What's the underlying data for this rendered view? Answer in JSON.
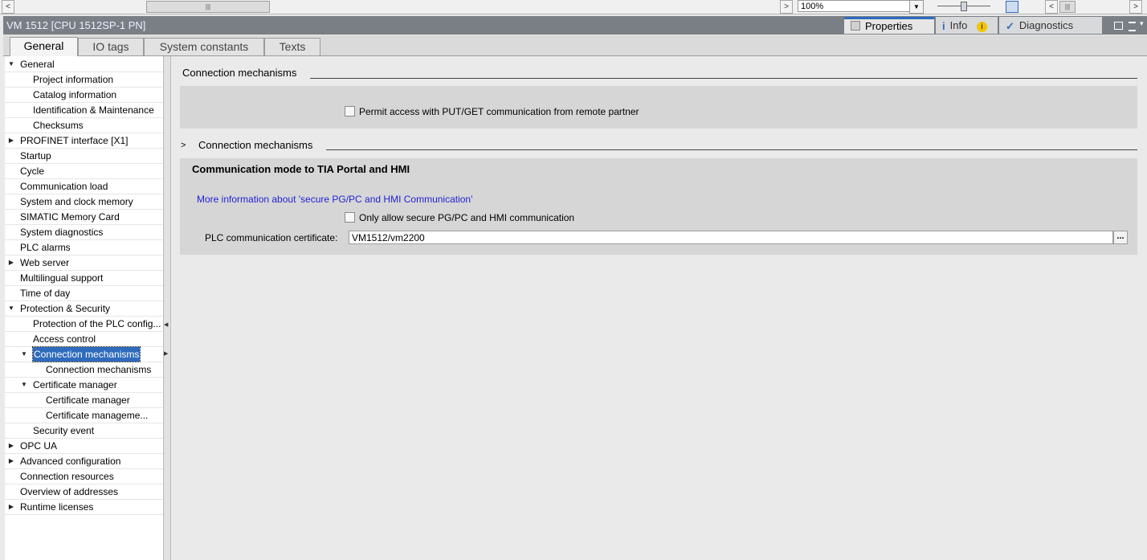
{
  "scrollbar": {
    "left_arrow": "<",
    "thumb_grip": "|||",
    "right_arrow": ">",
    "zoom_value": "100%",
    "zoom_dropdown": "▼",
    "pan_left": "<",
    "pan_grip": "|||",
    "pan_right": ">"
  },
  "inspector": {
    "title": "VM 1512 [CPU 1512SP-1 PN]",
    "tabs": {
      "properties": "Properties",
      "info": "Info",
      "diagnostics": "Diagnostics"
    }
  },
  "property_tabs": [
    "General",
    "IO tags",
    "System constants",
    "Texts"
  ],
  "tree": [
    {
      "label": "General",
      "level": 0,
      "expander": "open"
    },
    {
      "label": "Project information",
      "level": 1
    },
    {
      "label": "Catalog information",
      "level": 1
    },
    {
      "label": "Identification & Maintenance",
      "level": 1
    },
    {
      "label": "Checksums",
      "level": 1
    },
    {
      "label": "PROFINET interface [X1]",
      "level": 0,
      "expander": "closed"
    },
    {
      "label": "Startup",
      "level": 0
    },
    {
      "label": "Cycle",
      "level": 0
    },
    {
      "label": "Communication load",
      "level": 0
    },
    {
      "label": "System and clock memory",
      "level": 0
    },
    {
      "label": "SIMATIC Memory Card",
      "level": 0
    },
    {
      "label": "System diagnostics",
      "level": 0
    },
    {
      "label": "PLC alarms",
      "level": 0
    },
    {
      "label": "Web server",
      "level": 0,
      "expander": "closed"
    },
    {
      "label": "Multilingual support",
      "level": 0
    },
    {
      "label": "Time of day",
      "level": 0
    },
    {
      "label": "Protection & Security",
      "level": 0,
      "expander": "open"
    },
    {
      "label": "Protection of the PLC config...",
      "level": 1
    },
    {
      "label": "Access control",
      "level": 1
    },
    {
      "label": "Connection mechanisms",
      "level": 1,
      "expander": "open",
      "selected": true
    },
    {
      "label": "Connection mechanisms",
      "level": 2
    },
    {
      "label": "Certificate manager",
      "level": 1,
      "expander": "open"
    },
    {
      "label": "Certificate manager",
      "level": 2
    },
    {
      "label": "Certificate manageme...",
      "level": 2
    },
    {
      "label": "Security event",
      "level": 1
    },
    {
      "label": "OPC UA",
      "level": 0,
      "expander": "closed"
    },
    {
      "label": "Advanced configuration",
      "level": 0,
      "expander": "closed"
    },
    {
      "label": "Connection resources",
      "level": 0
    },
    {
      "label": "Overview of addresses",
      "level": 0
    },
    {
      "label": "Runtime licenses",
      "level": 0,
      "expander": "closed"
    }
  ],
  "content": {
    "section1_title": "Connection mechanisms",
    "putget_label": "Permit access with PUT/GET communication from remote partner",
    "putget_checked": false,
    "section2_expander": ">",
    "section2_title": "Connection mechanisms",
    "comm_mode_title": "Communication mode to TIA Portal and HMI",
    "more_info_link": "More information about 'secure PG/PC and HMI Communication'",
    "secure_only_label": "Only allow secure PG/PC and HMI communication",
    "secure_only_checked": false,
    "cert_label": "PLC communication certificate:",
    "cert_value": "VM1512/vm2200",
    "cert_browse": "..."
  },
  "colors": {
    "accent": "#2f6bbd",
    "link": "#1f1fd6",
    "titlebar": "#7a7f86"
  }
}
